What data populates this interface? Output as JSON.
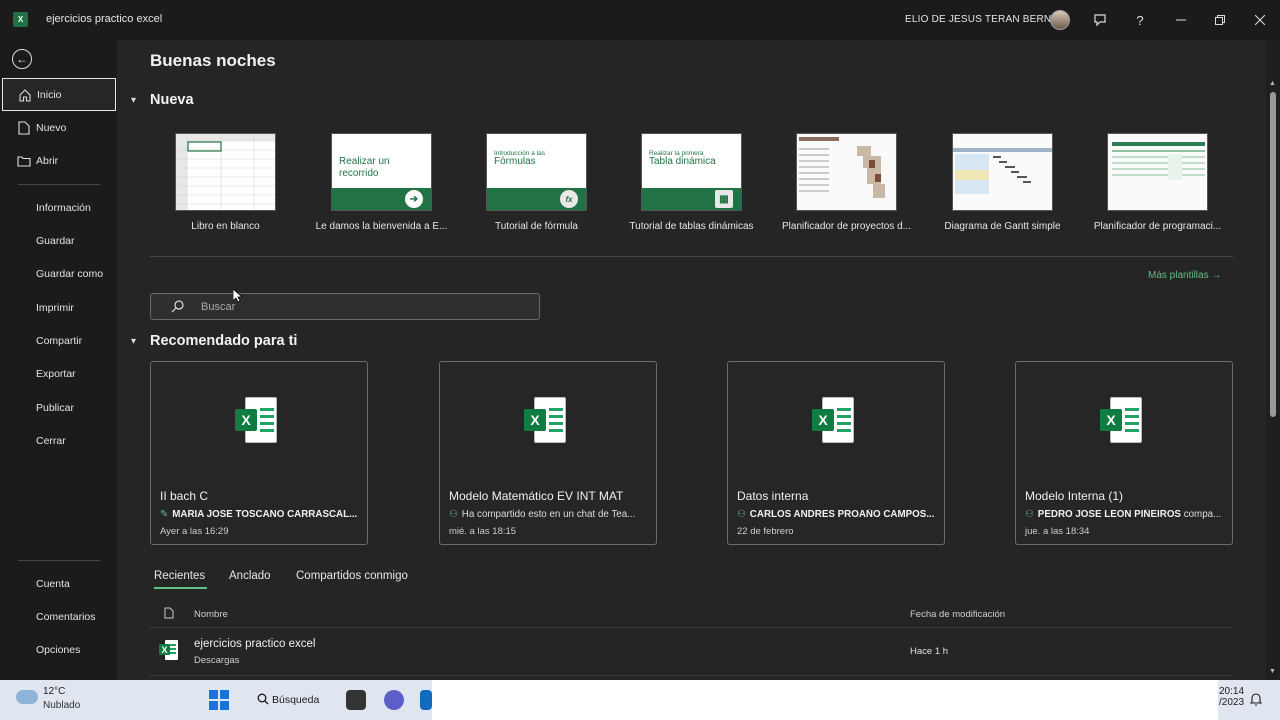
{
  "window": {
    "title": "ejercicios practico excel",
    "user_name": "ELIO DE JESUS TERAN BERNAL",
    "app_icon_letter": "X",
    "controls": [
      "feedback-icon",
      "help-icon",
      "minimize-icon",
      "restore-icon",
      "close-icon"
    ]
  },
  "sidebar": {
    "items": [
      {
        "label": "Inicio",
        "icon": "home-icon"
      },
      {
        "label": "Nuevo",
        "icon": "new-file-icon"
      },
      {
        "label": "Abrir",
        "icon": "folder-icon"
      },
      {
        "label": "Información"
      },
      {
        "label": "Guardar"
      },
      {
        "label": "Guardar como"
      },
      {
        "label": "Imprimir"
      },
      {
        "label": "Compartir"
      },
      {
        "label": "Exportar"
      },
      {
        "label": "Publicar"
      },
      {
        "label": "Cerrar"
      }
    ],
    "bottom_items": [
      {
        "label": "Cuenta"
      },
      {
        "label": "Comentarios"
      },
      {
        "label": "Opciones"
      }
    ]
  },
  "main": {
    "greeting": "Buenas noches",
    "new_section": "Nueva",
    "templates": [
      {
        "label": "Libro en blanco"
      },
      {
        "label": "Le damos la bienvenida a E...",
        "thumb_text": "Realizar un recorrido"
      },
      {
        "label": "Tutorial de fórmula",
        "thumb_text_small": "Introducción a las",
        "thumb_text": "Fórmulas"
      },
      {
        "label": "Tutorial de tablas dinámicas",
        "thumb_text_small": "Realizar la primera",
        "thumb_text": "Tabla dinámica"
      },
      {
        "label": "Planificador de proyectos d..."
      },
      {
        "label": "Diagrama de Gantt simple"
      },
      {
        "label": "Planificador de programaci..."
      }
    ],
    "more_templates": "Más plantillas →",
    "search_placeholder": "Buscar",
    "recommended_section": "Recomendado para ti",
    "recommended": [
      {
        "name": "II bach C",
        "person": "MARIA JOSE TOSCANO CARRASCAL...",
        "activity": "",
        "time": "Ayer a las 16:29",
        "icon": "pencil-icon"
      },
      {
        "name": "Modelo Matemático EV INT MAT",
        "person": "",
        "activity": "Ha compartido esto en un chat de Tea...",
        "time": "mié. a las 18:15",
        "icon": "people-icon"
      },
      {
        "name": "Datos interna",
        "person": "CARLOS ANDRES PROAÑO CAMPOS...",
        "activity": "",
        "time": "22 de febrero",
        "icon": "people-icon"
      },
      {
        "name": "Modelo Interna (1)",
        "person": "PEDRO JOSE LEON PIÑEIROS",
        "activity": " compa...",
        "time": "jue. a las 18:34",
        "icon": "people-icon"
      }
    ],
    "tabs": [
      "Recientes",
      "Anclado",
      "Compartidos conmigo"
    ],
    "columns": {
      "name": "Nombre",
      "date": "Fecha de modificación"
    },
    "files": [
      {
        "name": "ejercicios practico excel",
        "location": "Descargas",
        "modified": "Hace 1 h"
      }
    ]
  },
  "taskbar": {
    "temperature": "12°C",
    "weather": "Nublado",
    "search_label": "Búsqueda",
    "time": "20:14",
    "date": "/2023"
  },
  "colors": {
    "accent_green": "#217346",
    "link_green": "#5fbf84",
    "background": "#252525",
    "sidebar": "#1b1b1b"
  }
}
